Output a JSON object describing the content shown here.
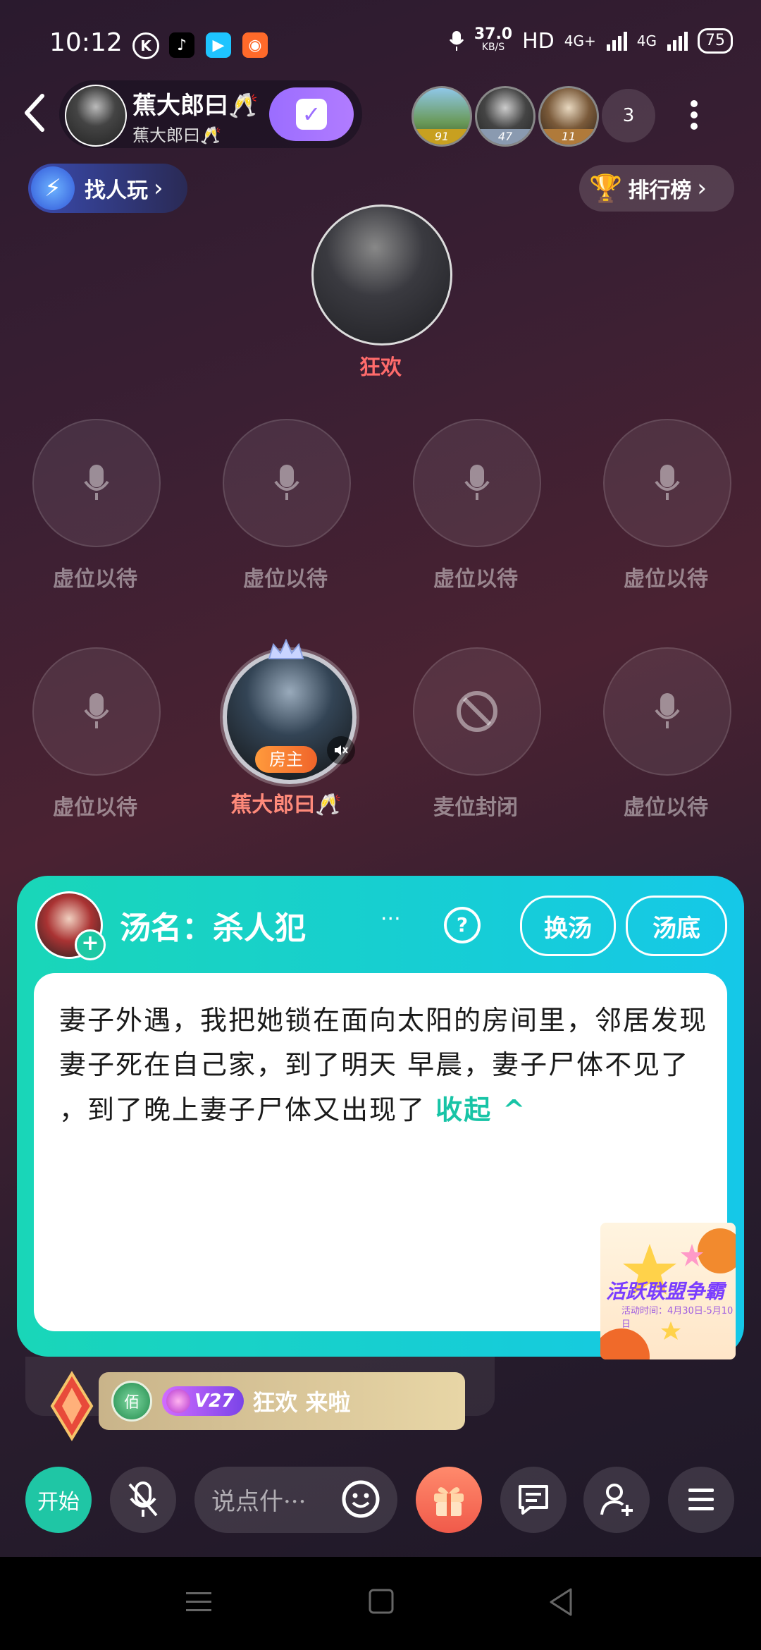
{
  "status_bar": {
    "time": "10:12",
    "net_speed": "37.0",
    "net_unit": "KB/S",
    "hd": "HD",
    "network_a": "4G+",
    "network_b": "4G",
    "battery": "75"
  },
  "room": {
    "name": "蕉大郎曰🥂",
    "sub_name": "蕉大郎曰🥂",
    "viewers": [
      {
        "badge": "91"
      },
      {
        "badge": "47"
      },
      {
        "badge": "11"
      }
    ],
    "viewer_count": "3"
  },
  "find_play_label": "找人玩",
  "rank_label": "排行榜",
  "host": {
    "name": "狂欢"
  },
  "seats": {
    "empty_label": "虚位以待",
    "closed_label": "麦位封闭",
    "owner_badge": "房主",
    "owner_name": "蕉大郎曰🥂"
  },
  "game_card": {
    "title": "汤名：杀人犯",
    "more": "···",
    "help": "?",
    "change_button": "换汤",
    "answer_button": "汤底",
    "story": "妻子外遇，我把她锁在面向太阳的房间里，邻居发现妻子死在自己家，到了明天 早晨，妻子尸体不见了 ，到了晚上妻子尸体又出现了",
    "collapse_label": "收起 ^",
    "promo_title": "活跃联盟争霸",
    "promo_sub": "活动时间：4月30日-5月10日"
  },
  "arrival": {
    "badge_hundred": "佰",
    "vip_level": "V27",
    "message": "狂欢 来啦"
  },
  "toolbar": {
    "start_label": "开始",
    "chat_placeholder": "说点什···"
  },
  "colors": {
    "accent": "#1fc6a5",
    "host_name": "#ff6b6b",
    "owner_name": "#ff8a7a",
    "card_gradient_start": "#19d6b8",
    "card_gradient_end": "#15c8e8"
  }
}
